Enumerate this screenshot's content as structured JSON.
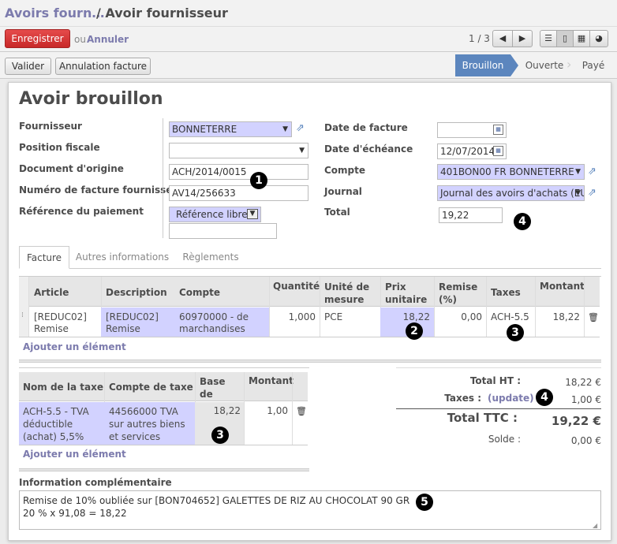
{
  "header": {
    "breadcrumb_parent": "Avoirs fourn…",
    "breadcrumb_current": "/ Avoir fournisseur"
  },
  "actions": {
    "save_label": "Enregistrer",
    "or_label": "ou",
    "cancel_label": "Annuler",
    "pager": "1 / 3"
  },
  "buttons": {
    "validate": "Valider",
    "cancel_invoice": "Annulation facture"
  },
  "status": {
    "stages": [
      "Brouillon",
      "Ouverte",
      "Payé"
    ],
    "active": "Brouillon"
  },
  "form": {
    "title": "Avoir brouillon",
    "left_labels": {
      "supplier": "Fournisseur",
      "fiscal_position": "Position fiscale",
      "origin": "Document d'origine",
      "supplier_invoice_number": "Numéro de facture fournisseur",
      "payment_ref": "Référence du paiement"
    },
    "left_values": {
      "supplier": "BONNETERRE",
      "fiscal_position": "",
      "origin": "ACH/2014/0015",
      "supplier_invoice_number": "AV14/256633",
      "payment_ref_type": "Référence libre",
      "payment_ref": ""
    },
    "right_labels": {
      "invoice_date": "Date de facture",
      "due_date": "Date d'échéance",
      "account": "Compte",
      "journal": "Journal",
      "total": "Total"
    },
    "right_values": {
      "invoice_date": "",
      "due_date": "12/07/2014",
      "account": "401BON00 FR BONNETERRE",
      "journal": "Journal des avoirs d'achats (EU",
      "total": "19,22"
    }
  },
  "markers": [
    "1",
    "2",
    "3",
    "3",
    "4",
    "4",
    "5"
  ],
  "tabs": [
    "Facture",
    "Autres informations",
    "Règlements"
  ],
  "lines": {
    "headers": [
      "Article",
      "Description",
      "Compte",
      "Quantité",
      "Unité de mesure",
      "Prix unitaire",
      "Remise (%)",
      "Taxes",
      "Montant"
    ],
    "row": {
      "article": "[REDUC02] Remise",
      "description": "[REDUC02] Remise",
      "account": "60970000 - de marchandises",
      "quantity": "1,000",
      "uom": "PCE",
      "unit_price": "18,22",
      "discount": "0,00",
      "taxes": "ACH-5.5",
      "amount": "18,22"
    },
    "add_item": "Ajouter un élément"
  },
  "taxes_table": {
    "headers": [
      "Nom de la taxe",
      "Compte de taxe",
      "Base de calcul",
      "Montant"
    ],
    "row": {
      "name": "ACH-5.5 - TVA déductible (achat) 5,5%",
      "account": "44566000 TVA sur autres biens et services",
      "base": "18,22",
      "amount": "1,00"
    },
    "add_item": "Ajouter un élément"
  },
  "totals": {
    "ht_label": "Total HT :",
    "ht": "18,22 €",
    "taxes_label": "Taxes :",
    "update_label": "(update)",
    "taxes": "1,00 €",
    "ttc_label": "Total TTC :",
    "ttc": "19,22 €",
    "balance_label": "Solde :",
    "balance": "0,00 €"
  },
  "notes": {
    "label": "Information complémentaire",
    "line1": "Remise de 10% oubliée sur [BON704652] GALETTES DE RIZ AU CHOCOLAT 90 GR",
    "line2": "20 % x 91,08 = 18,22"
  }
}
